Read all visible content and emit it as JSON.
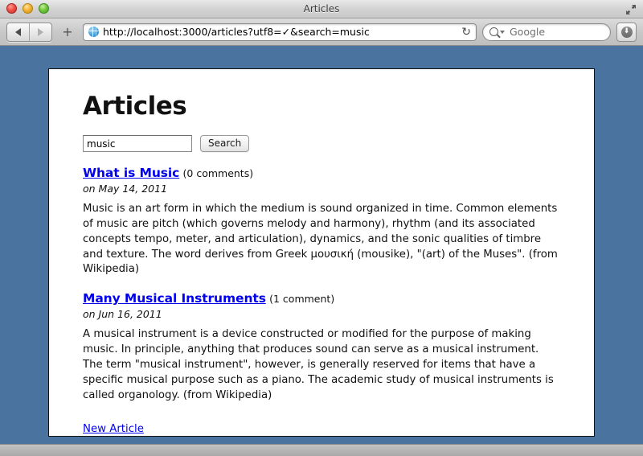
{
  "browser": {
    "window_title": "Articles",
    "traffic_lights": [
      "close-button",
      "minimize-button",
      "zoom-button"
    ],
    "add_tab_label": "+",
    "url": "http://localhost:3000/articles?utf8=✓&search=music",
    "reload_glyph": "↻",
    "search_placeholder": "Google",
    "downloads_glyph": "⬇",
    "back_label": "Back",
    "forward_label": "Forward"
  },
  "page": {
    "title": "Articles",
    "search": {
      "value": "music",
      "placeholder": "",
      "button_label": "Search"
    },
    "articles": [
      {
        "title": "What is Music",
        "comments": "(0 comments)",
        "date": "on May 14, 2011",
        "body": "Music is an art form in which the medium is sound organized in time. Common elements of music are pitch (which governs melody and harmony), rhythm (and its associated concepts tempo, meter, and articulation), dynamics, and the sonic qualities of timbre and texture. The word derives from Greek μουσική (mousike), \"(art) of the Muses\". (from Wikipedia)"
      },
      {
        "title": "Many Musical Instruments",
        "comments": "(1 comment)",
        "date": "on Jun 16, 2011",
        "body": "A musical instrument is a device constructed or modified for the purpose of making music. In principle, anything that produces sound can serve as a musical instrument. The term \"musical instrument\", however, is generally reserved for items that have a specific musical purpose such as a piano. The academic study of musical instruments is called organology. (from Wikipedia)"
      }
    ],
    "new_article_label": "New Article"
  },
  "colors": {
    "page_background": "#4a73a0",
    "link": "#0000ee",
    "content_background": "#ffffff"
  }
}
